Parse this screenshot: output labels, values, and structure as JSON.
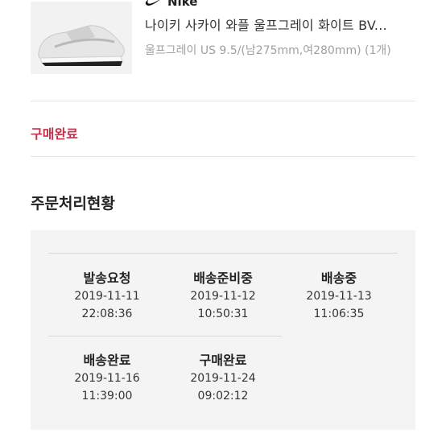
{
  "product": {
    "brand": "Nike",
    "title": "나이키 사카이 와플 울프그레이 화이트 BV...",
    "option": "울프그레이 US 9.5/(남275mm,여280mm) (1개)"
  },
  "order": {
    "status": "구매완료"
  },
  "timeline": {
    "title": "주문처리현황",
    "steps": [
      {
        "name": "발송요청",
        "date": "2019-11-11",
        "time": "22:08:36"
      },
      {
        "name": "배송준비중",
        "date": "2019-11-12",
        "time": "10:50:31"
      },
      {
        "name": "배송중",
        "date": "2019-11-13",
        "time": "11:06:35"
      },
      {
        "name": "배송완료",
        "date": "2019-11-16",
        "time": "11:39:00"
      },
      {
        "name": "구매완료",
        "date": "2019-11-24",
        "time": "09:02:12"
      }
    ]
  }
}
